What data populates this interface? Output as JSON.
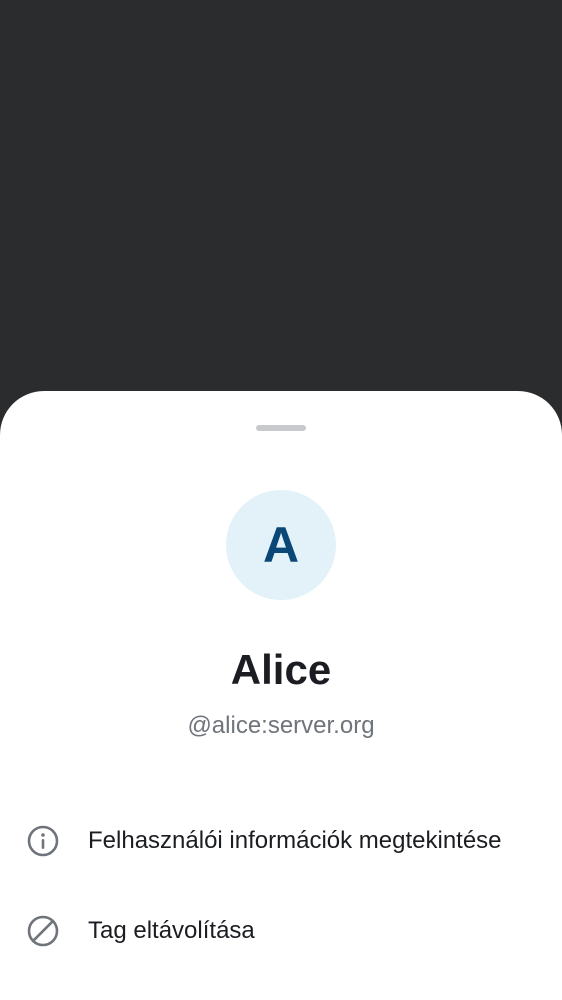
{
  "member_sheet": {
    "avatar_initial": "A",
    "display_name": "Alice",
    "user_id": "@alice:server.org",
    "actions": [
      {
        "label": "Felhasználói információk megtekintése",
        "icon": "info-icon"
      },
      {
        "label": "Tag eltávolítása",
        "icon": "block-icon"
      }
    ]
  },
  "colors": {
    "scrim": "#2b2c2e",
    "sheet_background": "#ffffff",
    "avatar_background": "#e2f2f8",
    "avatar_text": "#0a4776",
    "primary_text": "#1b1d22",
    "secondary_text": "#6f747b",
    "icon": "#6f747b"
  }
}
